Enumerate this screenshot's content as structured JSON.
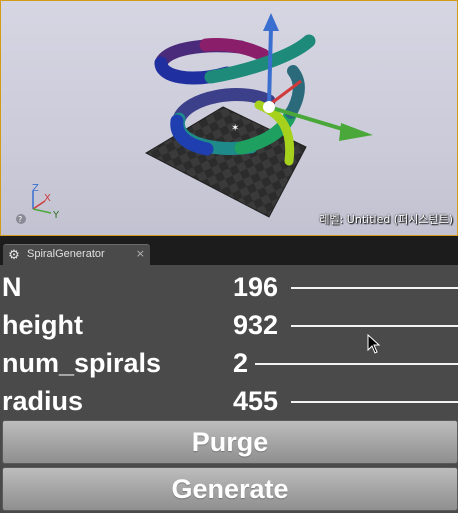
{
  "viewport": {
    "level_label": "레벨:  Untitled (퍼시스턴트)",
    "gizmo": {
      "z": "Z",
      "x": "X",
      "y": "Y",
      "help": "?"
    }
  },
  "tab": {
    "icon": "gear-icon",
    "label": "SpiralGenerator",
    "close": "×"
  },
  "properties": [
    {
      "name": "N",
      "value": "196"
    },
    {
      "name": "height",
      "value": "932"
    },
    {
      "name": "num_spirals",
      "value": "2"
    },
    {
      "name": "radius",
      "value": "455"
    }
  ],
  "buttons": {
    "purge": "Purge",
    "generate": "Generate"
  },
  "colors": {
    "viewport_border": "#d49a1a",
    "panel_bg": "#4a4a4a",
    "dock_bg": "#1c1c1c",
    "axis_z": "#3a6fd0",
    "axis_x": "#d03a3a",
    "axis_y": "#4aa83a"
  }
}
